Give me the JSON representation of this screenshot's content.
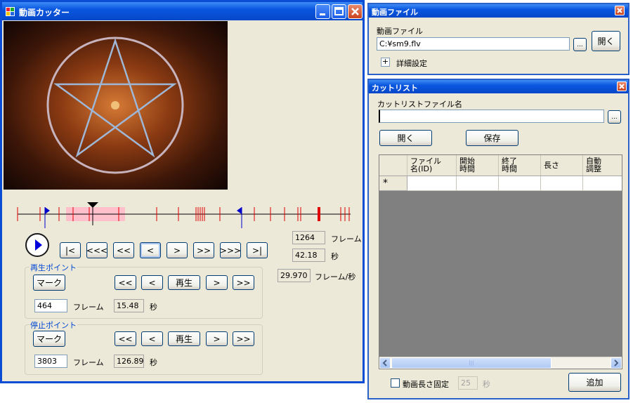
{
  "main_window": {
    "title": "動画カッター",
    "frame_value": "1264",
    "frame_unit": "フレーム",
    "seconds_value": "42.18",
    "seconds_unit": "秒",
    "fps_value": "29.970",
    "fps_unit": "フレーム/秒",
    "nav_buttons": [
      "|<",
      "<<<",
      "<<",
      "<",
      ">",
      ">>",
      ">>>",
      ">|"
    ],
    "play_point": {
      "title": "再生ポイント",
      "mark_label": "マーク",
      "frame_value": "464",
      "frame_unit": "フレーム",
      "seconds_value": "15.48",
      "seconds_unit": "秒",
      "buttons": [
        "<<",
        "<",
        "再生",
        ">",
        ">>"
      ]
    },
    "stop_point": {
      "title": "停止ポイント",
      "mark_label": "マーク",
      "frame_value": "3803",
      "frame_unit": "フレーム",
      "seconds_value": "126.89",
      "seconds_unit": "秒",
      "buttons": [
        "<<",
        "<",
        "再生",
        ">",
        ">>"
      ]
    }
  },
  "video_file_window": {
    "title": "動画ファイル",
    "field_label": "動画ファイル",
    "path_value": "C:¥sm9.flv",
    "browse_label": "...",
    "open_label": "開く",
    "expand_label": "+",
    "advanced_label": "詳細設定"
  },
  "cutlist_window": {
    "title": "カットリスト",
    "field_label": "カットリストファイル名",
    "filename_value": "",
    "browse_label": "...",
    "open_label": "開く",
    "save_label": "保存",
    "columns": [
      "ファイル\n名(ID)",
      "開始\n時間",
      "終了\n時間",
      "長さ",
      "自動\n調整"
    ],
    "new_row_marker": "*",
    "scroll_thumb_label": "|||",
    "fix_length_label": "動画長さ固定",
    "fix_length_value": "25",
    "fix_length_unit": "秒",
    "add_label": "追加"
  }
}
